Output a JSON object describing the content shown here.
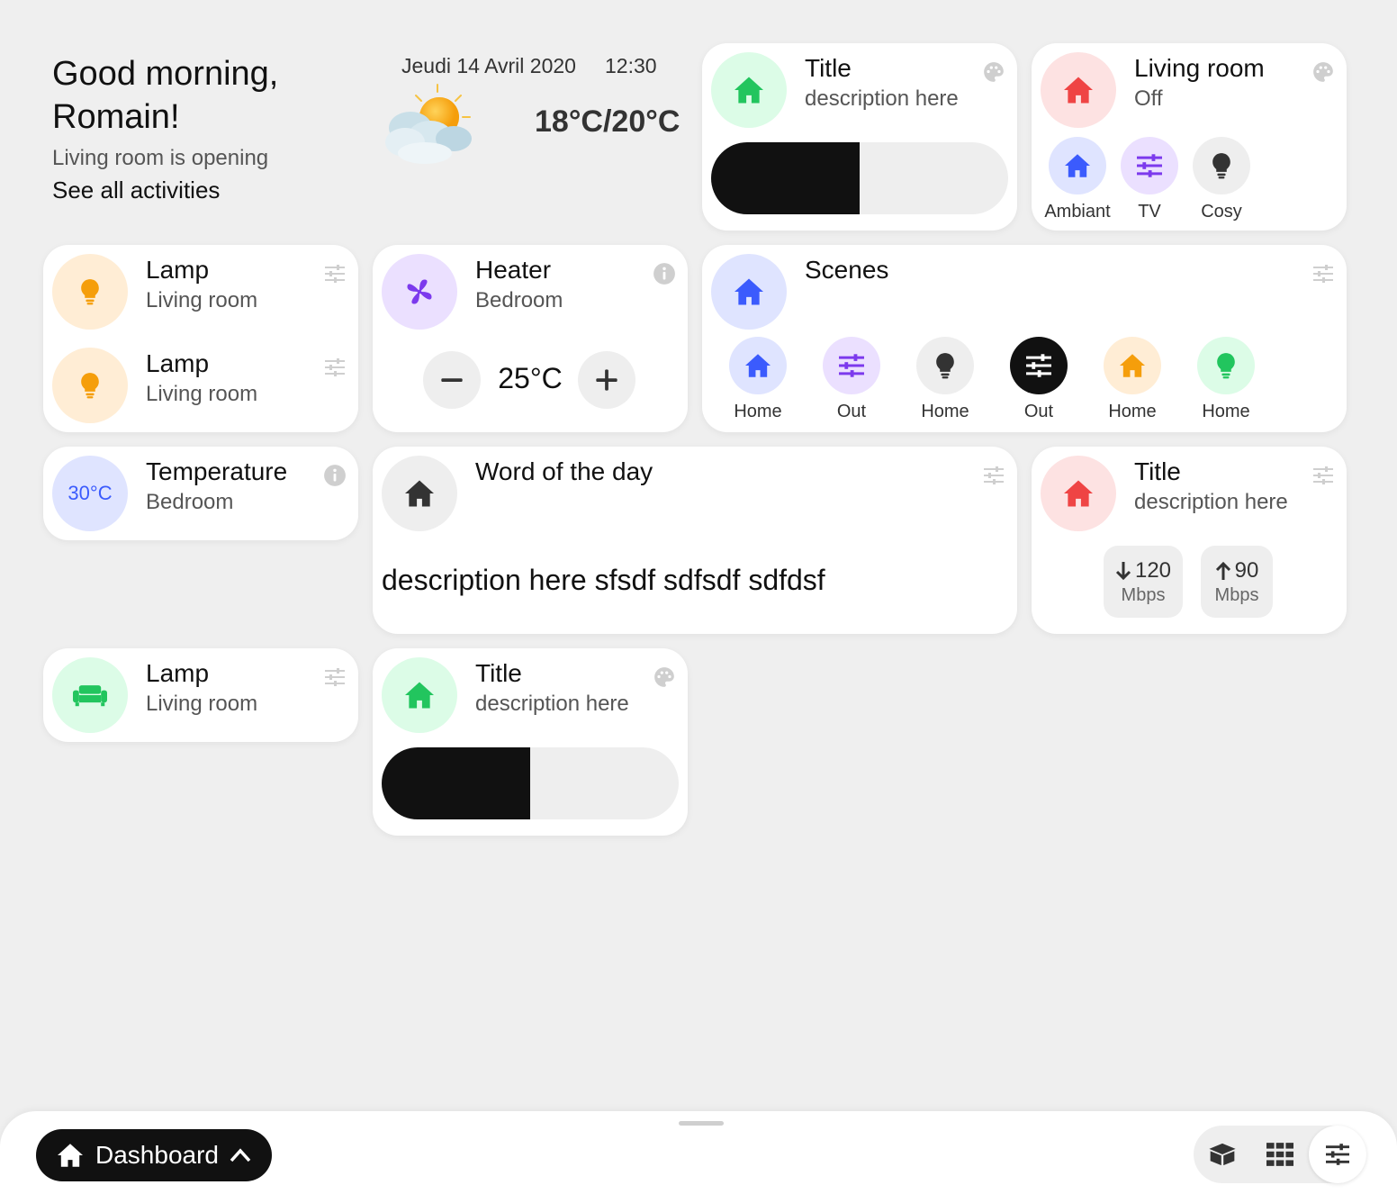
{
  "greeting": {
    "line1": "Good morning,",
    "line2": "Romain!",
    "status": "Living room is opening",
    "link": "See all activities"
  },
  "weather": {
    "date": "Jeudi 14 Avril 2020",
    "time": "12:30",
    "temp": "18°C/20°C",
    "icon": "partly-cloudy-icon"
  },
  "cards": {
    "title_slider_top": {
      "title": "Title",
      "description": "description here",
      "fill_percent": 50,
      "icon": "home-icon",
      "color": "#22c55e"
    },
    "living_room": {
      "title": "Living room",
      "status": "Off",
      "icon": "home-icon",
      "color": "#ef4444",
      "scenes": [
        {
          "label": "Ambiant",
          "icon": "home-icon",
          "color": "#3b5bfd",
          "bg": "#dfe4ff"
        },
        {
          "label": "TV",
          "icon": "sliders-icon",
          "color": "#7c3aed",
          "bg": "#ebe0ff"
        },
        {
          "label": "Cosy",
          "icon": "bulb-icon",
          "color": "#333333",
          "bg": "#eeeeee"
        }
      ]
    },
    "lamp1": {
      "title": "Lamp",
      "subtitle": "Living room",
      "icon": "bulb-icon",
      "color": "#f59e0b"
    },
    "lamp2": {
      "title": "Lamp",
      "subtitle": "Living room",
      "icon": "bulb-icon",
      "color": "#f59e0b"
    },
    "heater": {
      "title": "Heater",
      "subtitle": "Bedroom",
      "value": "25°C",
      "icon": "fan-icon",
      "color": "#7c3aed"
    },
    "scenes": {
      "title": "Scenes",
      "icon": "home-icon",
      "items": [
        {
          "label": "Home",
          "icon": "home-icon",
          "color": "#3b5bfd",
          "bg": "#dfe4ff"
        },
        {
          "label": "Out",
          "icon": "sliders-icon",
          "color": "#7c3aed",
          "bg": "#ebe0ff"
        },
        {
          "label": "Home",
          "icon": "bulb-icon",
          "color": "#333333",
          "bg": "#eeeeee"
        },
        {
          "label": "Out",
          "icon": "sliders-icon",
          "color": "#ffffff",
          "bg": "#111111"
        },
        {
          "label": "Home",
          "icon": "home-icon",
          "color": "#f59e0b",
          "bg": "#ffedd5"
        },
        {
          "label": "Home",
          "icon": "bulb-icon",
          "color": "#22c55e",
          "bg": "#dcfce7"
        }
      ]
    },
    "temperature": {
      "title": "Temperature",
      "subtitle": "Bedroom",
      "value": "30°C",
      "color": "#3b5bfd"
    },
    "word": {
      "title": "Word of the day",
      "text": "description here sfsdf sdfsdf sdfdsf",
      "icon": "home-icon"
    },
    "speed": {
      "title": "Title",
      "description": "description here",
      "icon": "home-icon",
      "color": "#ef4444",
      "down": {
        "value": "120",
        "unit": "Mbps"
      },
      "up": {
        "value": "90",
        "unit": "Mbps"
      }
    },
    "lamp3": {
      "title": "Lamp",
      "subtitle": "Living room",
      "icon": "sofa-icon",
      "color": "#22c55e"
    },
    "title_slider_bottom": {
      "title": "Title",
      "description": "description here",
      "fill_percent": 50,
      "icon": "home-icon",
      "color": "#22c55e"
    }
  },
  "bottombar": {
    "dashboard_label": "Dashboard",
    "icons": [
      "box-icon",
      "grid-icon",
      "sliders-icon"
    ]
  }
}
